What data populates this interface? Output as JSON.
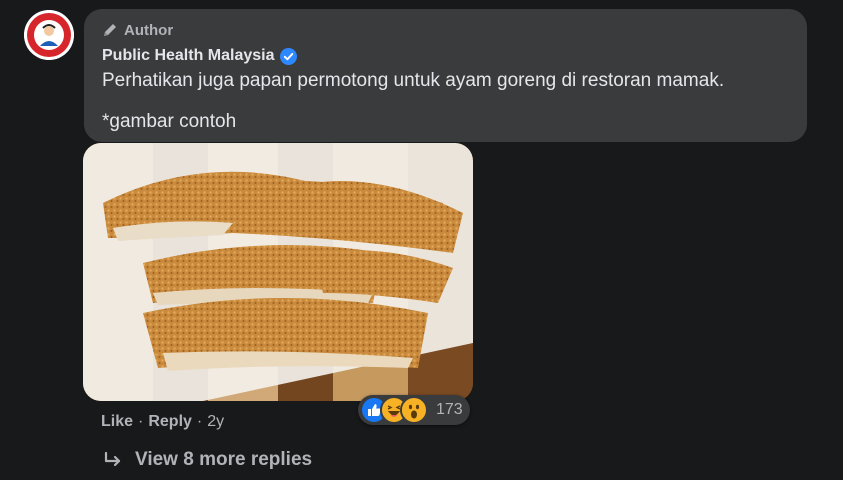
{
  "comment": {
    "author_badge": "Author",
    "page_name": "Public Health Malaysia",
    "verified": true,
    "lines": [
      "Perhatikan juga papan permotong untuk ayam goreng di restoran mamak.",
      "*gambar contoh"
    ],
    "avatar_icon": "healthcare-human-rights-logo",
    "photo_icon": "fried-chicken-on-cutting-board-photo"
  },
  "actions": {
    "like": "Like",
    "separator": "·",
    "reply": "Reply",
    "time": "2y"
  },
  "reactions": {
    "icons": [
      "like-icon",
      "haha-icon",
      "wow-icon"
    ],
    "count": "173"
  },
  "replies": {
    "label": "View 8 more replies",
    "icon": "reply-arrow-icon"
  },
  "colors": {
    "background": "#18191a",
    "bubble": "#3a3b3c",
    "text": "#e4e6eb",
    "secondary": "#b0b3b8",
    "verified": "#2d88ff",
    "like_blue": "#1877f2",
    "emoji_yellow": "#f7b125"
  }
}
